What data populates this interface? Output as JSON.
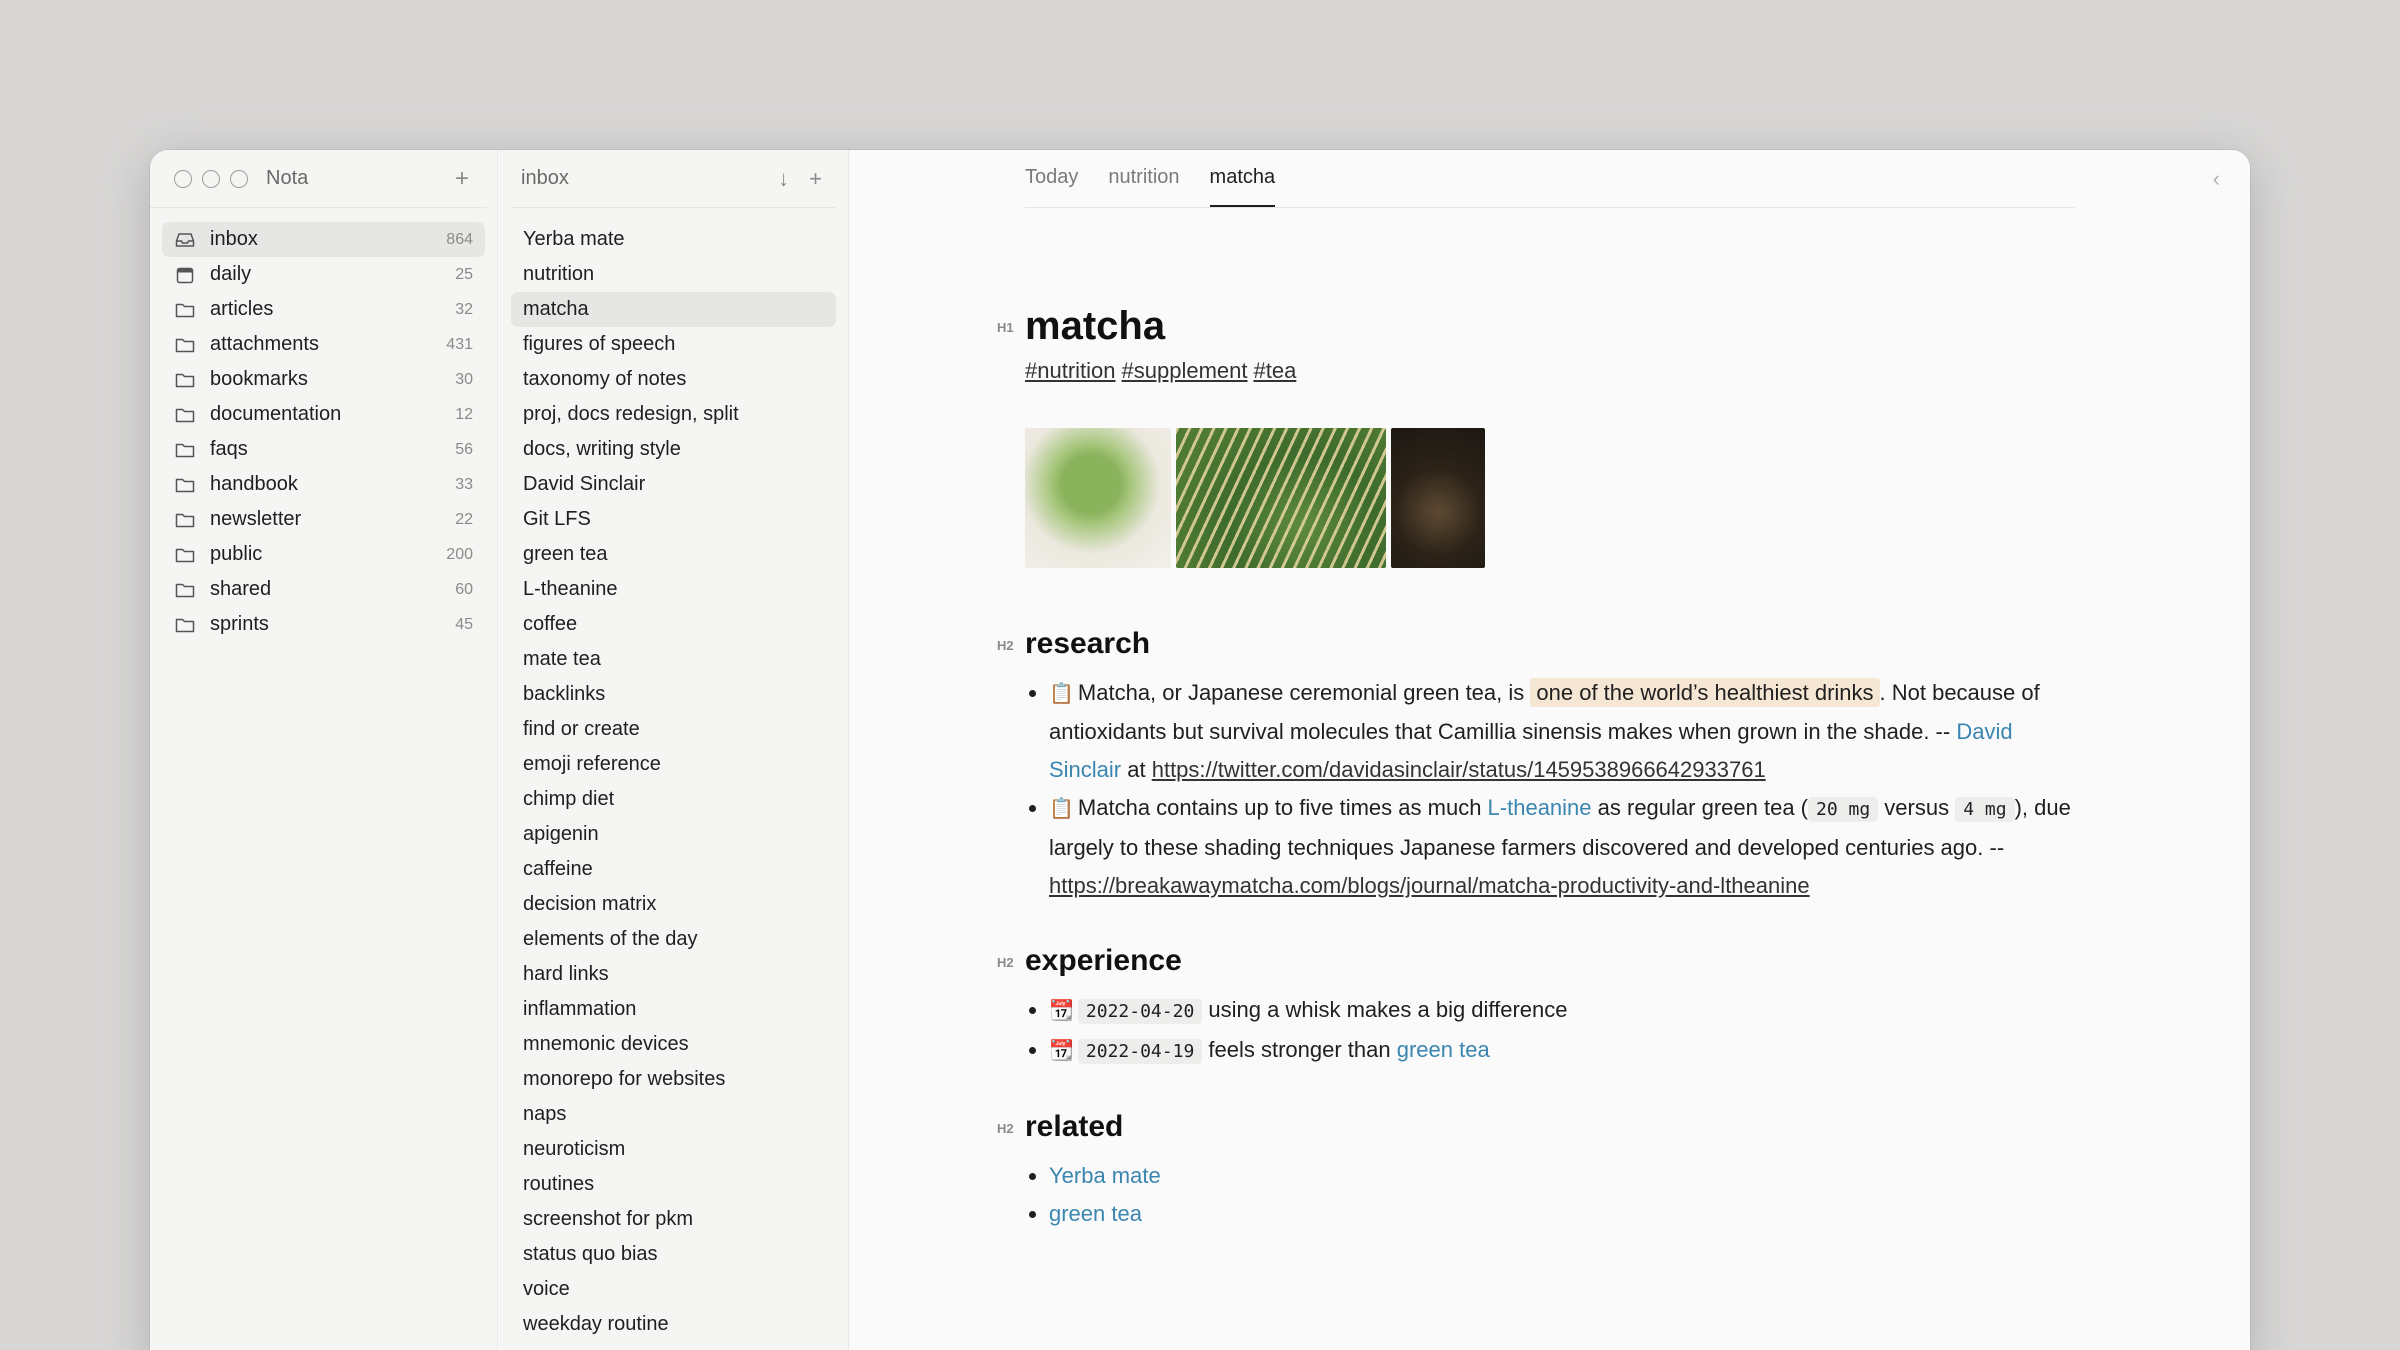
{
  "app": {
    "title": "Nota"
  },
  "sidebar": {
    "add_label": "+",
    "folders": [
      {
        "label": "inbox",
        "count": "864",
        "icon": "inbox-icon",
        "active": true
      },
      {
        "label": "daily",
        "count": "25",
        "icon": "calendar-icon"
      },
      {
        "label": "articles",
        "count": "32",
        "icon": "folder-icon"
      },
      {
        "label": "attachments",
        "count": "431",
        "icon": "folder-icon"
      },
      {
        "label": "bookmarks",
        "count": "30",
        "icon": "folder-icon"
      },
      {
        "label": "documentation",
        "count": "12",
        "icon": "folder-icon"
      },
      {
        "label": "faqs",
        "count": "56",
        "icon": "folder-icon"
      },
      {
        "label": "handbook",
        "count": "33",
        "icon": "folder-icon"
      },
      {
        "label": "newsletter",
        "count": "22",
        "icon": "folder-icon"
      },
      {
        "label": "public",
        "count": "200",
        "icon": "folder-icon"
      },
      {
        "label": "shared",
        "count": "60",
        "icon": "folder-icon"
      },
      {
        "label": "sprints",
        "count": "45",
        "icon": "folder-icon"
      }
    ]
  },
  "notelist": {
    "title": "inbox",
    "sort_label": "↓",
    "add_label": "+",
    "notes": [
      "Yerba mate",
      "nutrition",
      "matcha",
      "figures of speech",
      "taxonomy of notes",
      "proj, docs redesign, split",
      "docs, writing style",
      "David Sinclair",
      "Git LFS",
      "green tea",
      "L-theanine",
      "coffee",
      "mate tea",
      "backlinks",
      "find or create",
      "emoji reference",
      "chimp diet",
      "apigenin",
      "caffeine",
      "decision matrix",
      "elements of the day",
      "hard links",
      "inflammation",
      "mnemonic devices",
      "monorepo for websites",
      "naps",
      "neuroticism",
      "routines",
      "screenshot for pkm",
      "status quo bias",
      "voice",
      "weekday routine"
    ],
    "active_index": 2
  },
  "editor": {
    "tabs": [
      {
        "label": "Today"
      },
      {
        "label": "nutrition"
      },
      {
        "label": "matcha",
        "active": true
      }
    ],
    "back_label": "‹",
    "h1_marker": "H1",
    "h2_marker": "H2",
    "title": "matcha",
    "tags": [
      "#nutrition",
      "#supplement",
      "#tea"
    ],
    "images": [
      "matcha-powder-spoon",
      "matcha-whisk",
      "matcha-cup"
    ],
    "sections": {
      "research": {
        "heading": "research",
        "b1": {
          "emoji": "📋",
          "t1": "Matcha, or Japanese ceremonial green tea, is ",
          "highlight": "one of the world’s healthiest drinks",
          "t2": ". Not because of antioxidants but survival molecules that Camillia sinensis makes when grown in the shade. -- ",
          "link": "David Sinclair",
          "t3": " at ",
          "url": "https://twitter.com/davidasinclair/status/1459538966642933761"
        },
        "b2": {
          "emoji": "📋",
          "t1": "Matcha contains up to five times as much ",
          "link": "L-theanine",
          "t2": " as regular green tea (",
          "code1": "20 mg",
          "t3": " versus ",
          "code2": "4 mg",
          "t4": "), due largely to these shading techniques Japanese farmers discovered and developed centuries ago. -- ",
          "url": "https://breakawaymatcha.com/blogs/journal/matcha-productivity-and-ltheanine"
        }
      },
      "experience": {
        "heading": "experience",
        "items": [
          {
            "emoji": "📆",
            "date": "2022-04-20",
            "text": " using a whisk makes a big difference",
            "link": ""
          },
          {
            "emoji": "📆",
            "date": "2022-04-19",
            "text": " feels stronger than ",
            "link": "green tea"
          }
        ]
      },
      "related": {
        "heading": "related",
        "links": [
          "Yerba mate",
          "green tea"
        ]
      }
    }
  }
}
